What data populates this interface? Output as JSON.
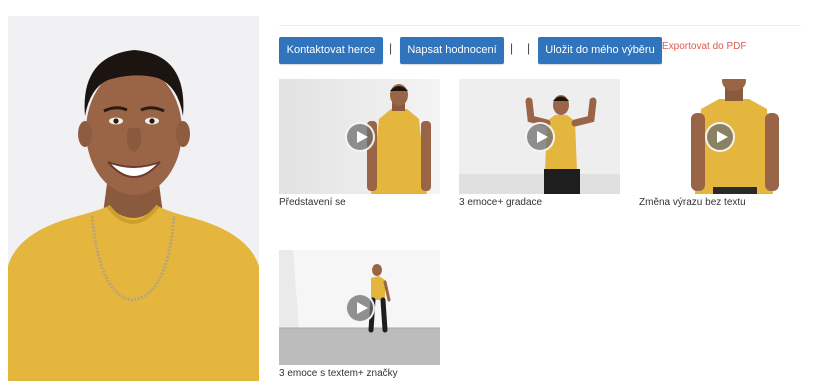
{
  "actions": {
    "contact_label": "Kontaktovat herce",
    "review_label": "Napsat hodnocení",
    "save_label": "Uložit do mého výběru",
    "pdf_label": "Exportovat do PDF",
    "separator": "|"
  },
  "videos": [
    {
      "title": "Představení se"
    },
    {
      "title": "3 emoce+ gradace"
    },
    {
      "title": "Změna výrazu bez textu"
    },
    {
      "title": "3 emoce s textem+ značky"
    }
  ],
  "colors": {
    "button_bg": "#2f74bd",
    "link": "#e05a4e",
    "shirt": "#e4b63d"
  },
  "icons": {
    "play": "play-icon"
  }
}
